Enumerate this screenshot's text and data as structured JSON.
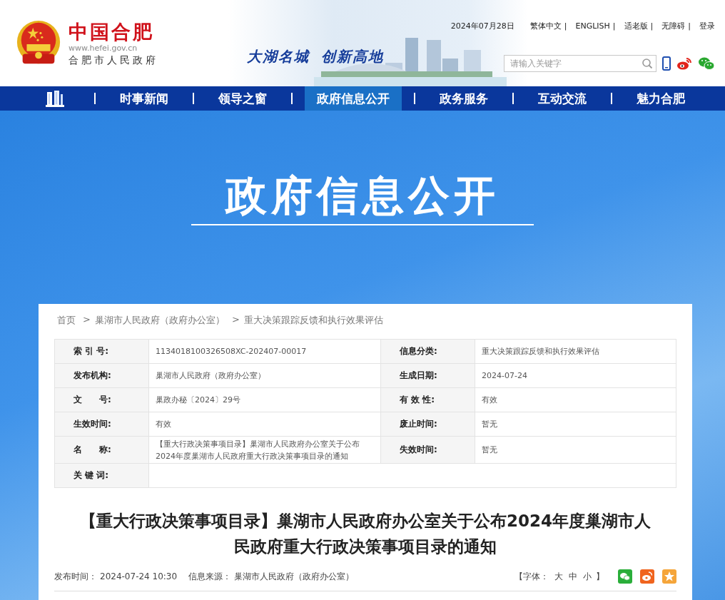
{
  "header": {
    "logo_title": "中国合肥",
    "logo_url": "www.hefei.gov.cn",
    "logo_subtitle": "合肥市人民政府",
    "slogan": [
      "大湖名城",
      "创新高地"
    ],
    "date": "2024年07月28日",
    "link_separator": "|",
    "links": [
      "繁体中文",
      "ENGLISH",
      "适老版",
      "无障碍",
      "登录"
    ],
    "search": {
      "placeholder": "请输入关键字"
    }
  },
  "nav": [
    {
      "kind": "icon",
      "selected": false
    },
    {
      "kind": "text",
      "label": "时事新闻",
      "selected": false
    },
    {
      "kind": "text",
      "label": "领导之窗",
      "selected": false
    },
    {
      "kind": "text",
      "label": "政府信息公开",
      "selected": true
    },
    {
      "kind": "text",
      "label": "政务服务",
      "selected": false
    },
    {
      "kind": "text",
      "label": "互动交流",
      "selected": false
    },
    {
      "kind": "text",
      "label": "魅力合肥",
      "selected": false
    }
  ],
  "banner": {
    "title": "政府信息公开"
  },
  "breadcrumb": {
    "separator": ">",
    "items": [
      "首页",
      "巢湖市人民政府（政府办公室）",
      "重大决策跟踪反馈和执行效果评估"
    ]
  },
  "info_table": [
    [
      {
        "label": "索 引 号:",
        "value": "1134018100326508XC-202407-00017"
      },
      {
        "label": "信息分类:",
        "value": "重大决策跟踪反馈和执行效果评估"
      }
    ],
    [
      {
        "label": "发布机构:",
        "value": "巢湖市人民政府（政府办公室）"
      },
      {
        "label": "生成日期:",
        "value": "2024-07-24"
      }
    ],
    [
      {
        "label": "文　　号:",
        "value": "巢政办秘〔2024〕29号"
      },
      {
        "label": "有 效 性:",
        "value": "有效"
      }
    ],
    [
      {
        "label": "生效时间:",
        "value": "有效"
      },
      {
        "label": "废止时间:",
        "value": "暂无"
      }
    ],
    [
      {
        "label": "名　　称:",
        "value": "【重大行政决策事项目录】巢湖市人民政府办公室关于公布2024年度巢湖市人民政府重大行政决策事项目录的通知"
      },
      {
        "label": "失效时间:",
        "value": "暂无"
      }
    ],
    [
      {
        "label": "关 键 词:"
      }
    ]
  ],
  "article": {
    "title": "【重大行政决策事项目录】巢湖市人民政府办公室关于公布2024年度巢湖市人民政府重大行政决策事项目录的通知",
    "meta": [
      {
        "label": "发布时间：",
        "value": "2024-07-24 10:30"
      },
      {
        "label": "信息来源：",
        "value": "巢湖市人民政府（政府办公室）"
      }
    ],
    "font_open": "【字体：",
    "font_sizes": [
      "大",
      "中",
      "小"
    ],
    "font_close": "】",
    "share": [
      {
        "kind": "wechat",
        "color": "#2aae3a"
      },
      {
        "kind": "weibo",
        "color": "#f0641e"
      },
      {
        "kind": "favorite",
        "color": "#f5a53a"
      }
    ]
  }
}
